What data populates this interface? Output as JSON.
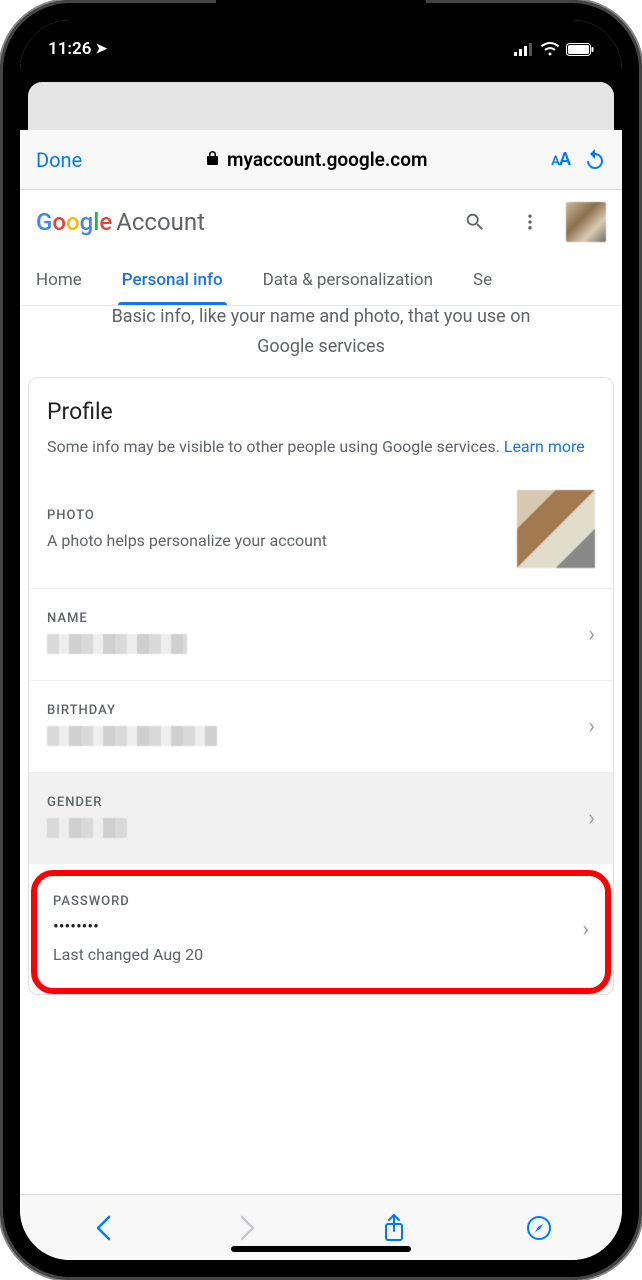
{
  "status": {
    "time": "11:26",
    "location_active": true
  },
  "safari": {
    "done_label": "Done",
    "url": "myaccount.google.com",
    "aa_label": "AA"
  },
  "header": {
    "logo_brand": "Google",
    "logo_product": "Account"
  },
  "tabs": [
    {
      "label": "Home",
      "active": false
    },
    {
      "label": "Personal info",
      "active": true
    },
    {
      "label": "Data & personalization",
      "active": false
    },
    {
      "label": "Se",
      "active": false
    }
  ],
  "intro": {
    "clipped_line": "Basic info, like your name and photo, that you use on",
    "line2": "Google services"
  },
  "profile_card": {
    "title": "Profile",
    "subtitle_prefix": "Some info may be visible to other people using Google services. ",
    "learn_more": "Learn more",
    "rows": {
      "photo": {
        "label": "PHOTO",
        "desc": "A photo helps personalize your account"
      },
      "name": {
        "label": "NAME"
      },
      "birthday": {
        "label": "BIRTHDAY"
      },
      "gender": {
        "label": "GENDER"
      },
      "password": {
        "label": "PASSWORD",
        "value": "••••••••",
        "sub": "Last changed Aug 20"
      }
    }
  }
}
